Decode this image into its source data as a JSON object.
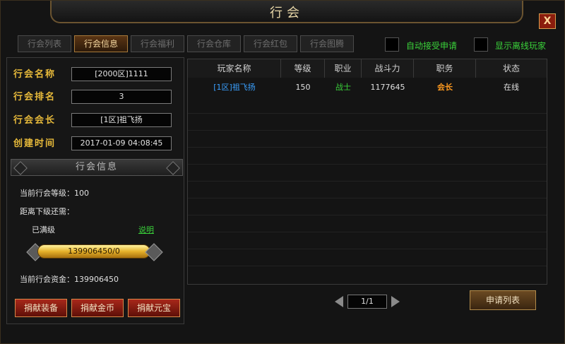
{
  "window": {
    "title": "行会",
    "close_label": "X"
  },
  "tabs": [
    {
      "label": "行会列表"
    },
    {
      "label": "行会信息"
    },
    {
      "label": "行会福利"
    },
    {
      "label": "行会仓库"
    },
    {
      "label": "行会红包"
    },
    {
      "label": "行会图腾"
    }
  ],
  "active_tab": 1,
  "options": {
    "auto_accept": "自动接受申请",
    "show_offline": "显示离线玩家"
  },
  "info": {
    "name_label": "行会名称",
    "name_value": "[2000区]1111",
    "rank_label": "行会排名",
    "rank_value": "3",
    "leader_label": "行会会长",
    "leader_value": "[1区]祖飞扬",
    "created_label": "创建时间",
    "created_value": "2017-01-09 04:08:45"
  },
  "section_title": "行会信息",
  "level_text": "当前行会等级：100",
  "next_need_text": "距离下级还需：",
  "maxed_text": "已满级",
  "explain_link": "说明",
  "progress_text": "139906450/0",
  "funds_text": "当前行会资金：139906450",
  "buttons": {
    "donate_equip": "捐献装备",
    "donate_gold": "捐献金币",
    "donate_ingot": "捐献元宝",
    "apply_list": "申请列表"
  },
  "table": {
    "headers": [
      "玩家名称",
      "等级",
      "职业",
      "战斗力",
      "职务",
      "状态"
    ],
    "rows": [
      {
        "name": "[1区]祖飞扬",
        "level": "150",
        "class": "战士",
        "power": "1177645",
        "position": "会长",
        "status": "在线"
      }
    ]
  },
  "pager": {
    "text": "1/1"
  },
  "colors": {
    "name_blue": "#3aa0ff",
    "class_green": "#3ad23a",
    "position_orange": "#ff9a1f",
    "label_gold": "#e6b93a"
  }
}
